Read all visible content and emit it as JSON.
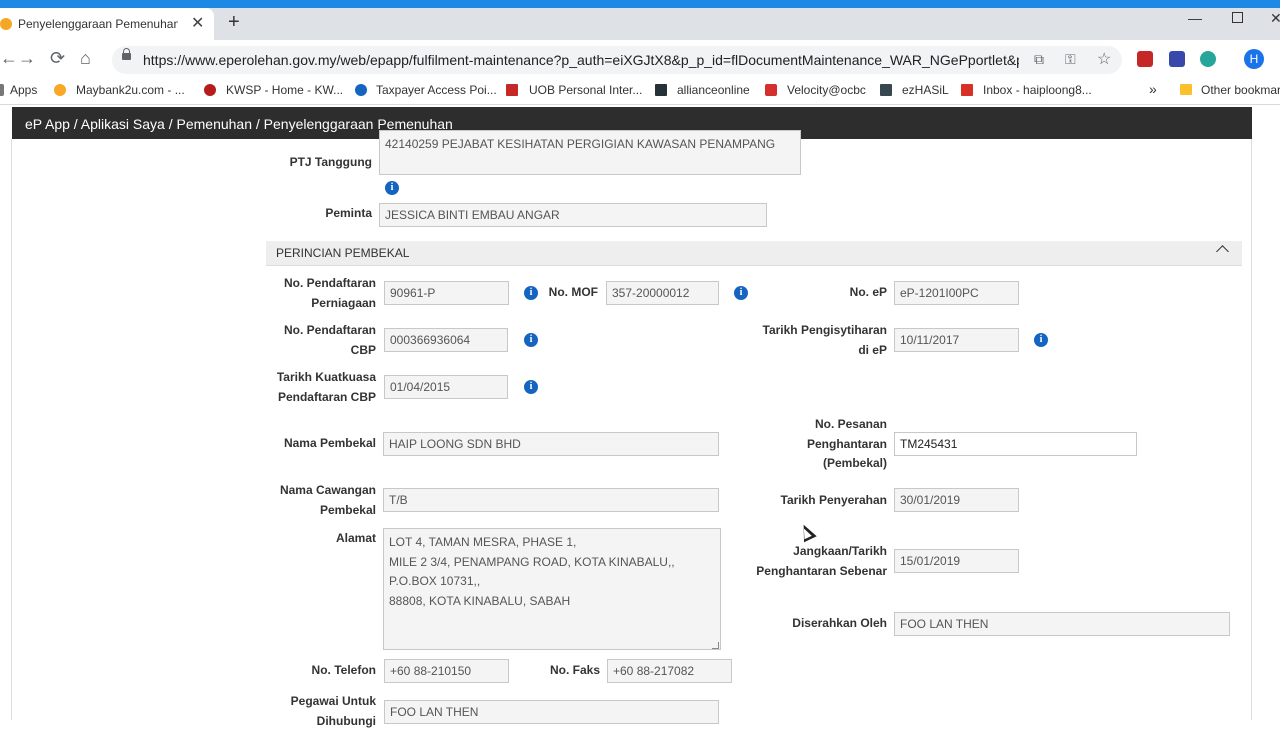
{
  "browser": {
    "tab_title": "Penyelenggaraan Pemenuhan - e",
    "tab_close": "✕",
    "new_tab": "+",
    "back": "←",
    "forward": "→",
    "reload": "⟳",
    "home": "⌂",
    "url": "https://www.eperolehan.gov.my/web/epapp/fulfilment-maintenance?p_auth=eiXGJtX8&p_p_id=flDocumentMaintenance_WAR_NGePportlet&p...",
    "profile_initial": "H",
    "win_min": "—",
    "win_close": "✕",
    "star": "☆",
    "key": "⚿",
    "translate": "⧉",
    "bookmarks": [
      {
        "label": "Apps"
      },
      {
        "label": "Maybank2u.com - ..."
      },
      {
        "label": "KWSP - Home - KW..."
      },
      {
        "label": "Taxpayer Access Poi..."
      },
      {
        "label": "UOB Personal Inter..."
      },
      {
        "label": "allianceonline"
      },
      {
        "label": "Velocity@ocbc"
      },
      {
        "label": "ezHASiL"
      },
      {
        "label": "Inbox - haiploong8..."
      },
      {
        "label": "Other bookmar"
      }
    ],
    "more_bookmarks": "»"
  },
  "app": {
    "breadcrumb": "eP App / Aplikasi Saya / Pemenuhan / Penyelenggaraan Pemenuhan"
  },
  "form_top": {
    "ptj_label": "PTJ Tanggung",
    "ptj_value": "42140259 PEJABAT KESIHATAN PERGIGIAN KAWASAN PENAMPANG",
    "peminta_label": "Peminta",
    "peminta_value": "JESSICA BINTI EMBAU ANGAR"
  },
  "section": {
    "title": "PERINCIAN PEMBEKAL"
  },
  "info_glyph": "i",
  "supplier": {
    "reg_no_label_1": "No. Pendaftaran",
    "reg_no_label_2": "Perniagaan",
    "reg_no_value": "90961-P",
    "mof_label": "No. MOF",
    "mof_value": "357-20000012",
    "ep_label": "No. eP",
    "ep_value": "eP-1201I00PC",
    "cbp_label_1": "No. Pendaftaran",
    "cbp_label_2": "CBP",
    "cbp_value": "000366936064",
    "decl_date_label_1": "Tarikh Pengisytiharan",
    "decl_date_label_2": "di eP",
    "decl_date_value": "10/11/2017",
    "cbp_eff_label_1": "Tarikh Kuatkuasa",
    "cbp_eff_label_2": "Pendaftaran CBP",
    "cbp_eff_value": "01/04/2015",
    "name_label": "Nama Pembekal",
    "name_value": "HAIP LOONG SDN BHD",
    "po_label_1": "No. Pesanan",
    "po_label_2": "Penghantaran",
    "po_label_3": "(Pembekal)",
    "po_value": "TM245431",
    "branch_label_1": "Nama Cawangan",
    "branch_label_2": "Pembekal",
    "branch_value": "T/B",
    "submit_date_label": "Tarikh Penyerahan",
    "submit_date_value": "30/01/2019",
    "address_label": "Alamat",
    "address_lines": [
      "LOT 4, TAMAN MESRA, PHASE 1,",
      "MILE 2 3/4, PENAMPANG ROAD, KOTA KINABALU,,",
      "P.O.BOX 10731,,",
      "88808, KOTA KINABALU, SABAH"
    ],
    "delivery_label_1": "Jangkaan/Tarikh",
    "delivery_label_2": "Penghantaran Sebenar",
    "delivery_value": "15/01/2019",
    "submitted_by_label": "Diserahkan Oleh",
    "submitted_by_value": "FOO LAN THEN",
    "phone_label": "No. Telefon",
    "phone_value": "+60  88-210150",
    "fax_label": "No. Faks",
    "fax_value": "+60  88-217082",
    "contact_label_1": "Pegawai Untuk",
    "contact_label_2": "Dihubungi",
    "contact_value": "FOO LAN THEN"
  }
}
